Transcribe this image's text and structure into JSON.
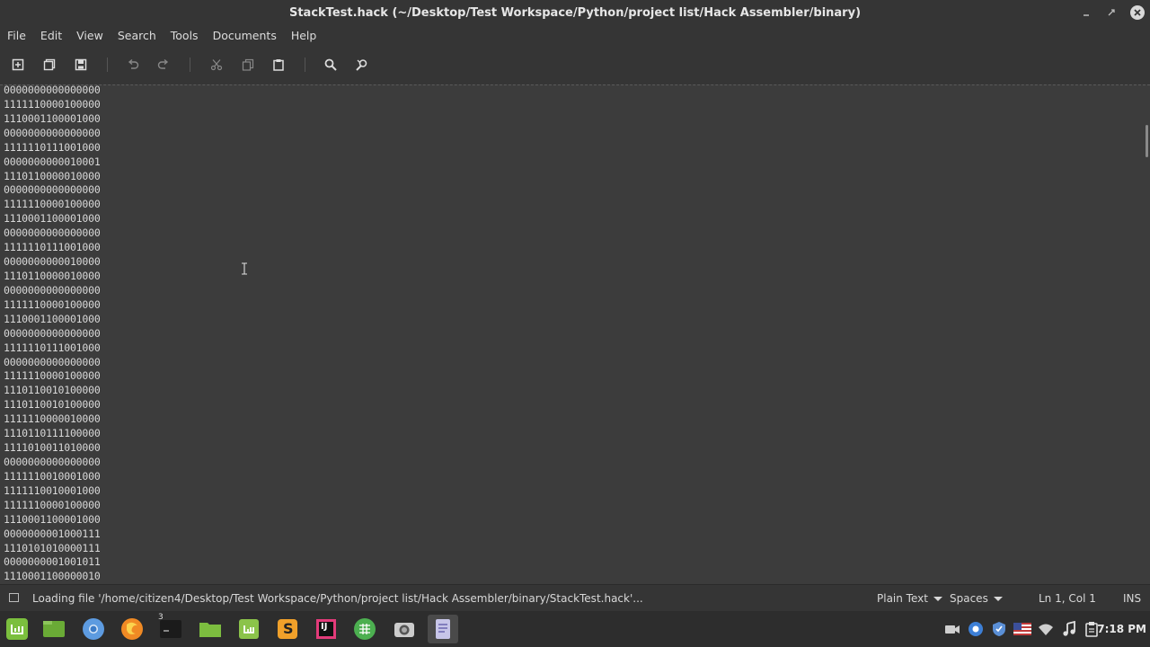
{
  "window": {
    "title": "StackTest.hack (~/Desktop/Test Workspace/Python/project list/Hack Assembler/binary)"
  },
  "menu": [
    "File",
    "Edit",
    "View",
    "Search",
    "Tools",
    "Documents",
    "Help"
  ],
  "toolbar": {
    "icons": [
      "new-document-icon",
      "open-document-icon",
      "save-icon",
      "undo-icon",
      "redo-icon",
      "cut-icon",
      "copy-icon",
      "paste-icon",
      "search-icon",
      "replace-icon"
    ]
  },
  "editor": {
    "lines": [
      "0000000000000000",
      "1111110000100000",
      "1110001100001000",
      "0000000000000000",
      "1111110111001000",
      "0000000000010001",
      "1110110000010000",
      "0000000000000000",
      "1111110000100000",
      "1110001100001000",
      "0000000000000000",
      "1111110111001000",
      "0000000000010000",
      "1110110000010000",
      "0000000000000000",
      "1111110000100000",
      "1110001100001000",
      "0000000000000000",
      "1111110111001000",
      "0000000000000000",
      "1111110000100000",
      "1110110010100000",
      "1110110010100000",
      "1111110000010000",
      "1110110111100000",
      "1111010011010000",
      "0000000000000000",
      "1111110010001000",
      "1111110010001000",
      "1111110000100000",
      "1110001100001000",
      "0000000001000111",
      "1110101010000111",
      "0000000001001011",
      "1110001100000010"
    ]
  },
  "status": {
    "message": "Loading file '/home/citizen4/Desktop/Test Workspace/Python/project list/Hack Assembler/binary/StackTest.hack'...",
    "language": "Plain Text",
    "indent": "Spaces",
    "position": "Ln 1, Col 1",
    "mode": "INS"
  },
  "taskbar": {
    "apps": [
      "mint-menu-icon",
      "files-icon",
      "chromium-icon",
      "firefox-icon",
      "terminal-icon",
      "folder-icon",
      "mint-update-icon",
      "sublime-text-icon",
      "intellij-icon",
      "spreadsheet-icon",
      "camera-icon",
      "text-editor-icon"
    ],
    "terminal_badge": "3",
    "sublime_letter": "S",
    "intellij_letters": "IJ",
    "clock": "7:18 PM"
  },
  "colors": {
    "background": "#3c3c3c",
    "chrome": "#353535",
    "text": "#d8d8d8",
    "taskbar": "#2d2d2d"
  }
}
